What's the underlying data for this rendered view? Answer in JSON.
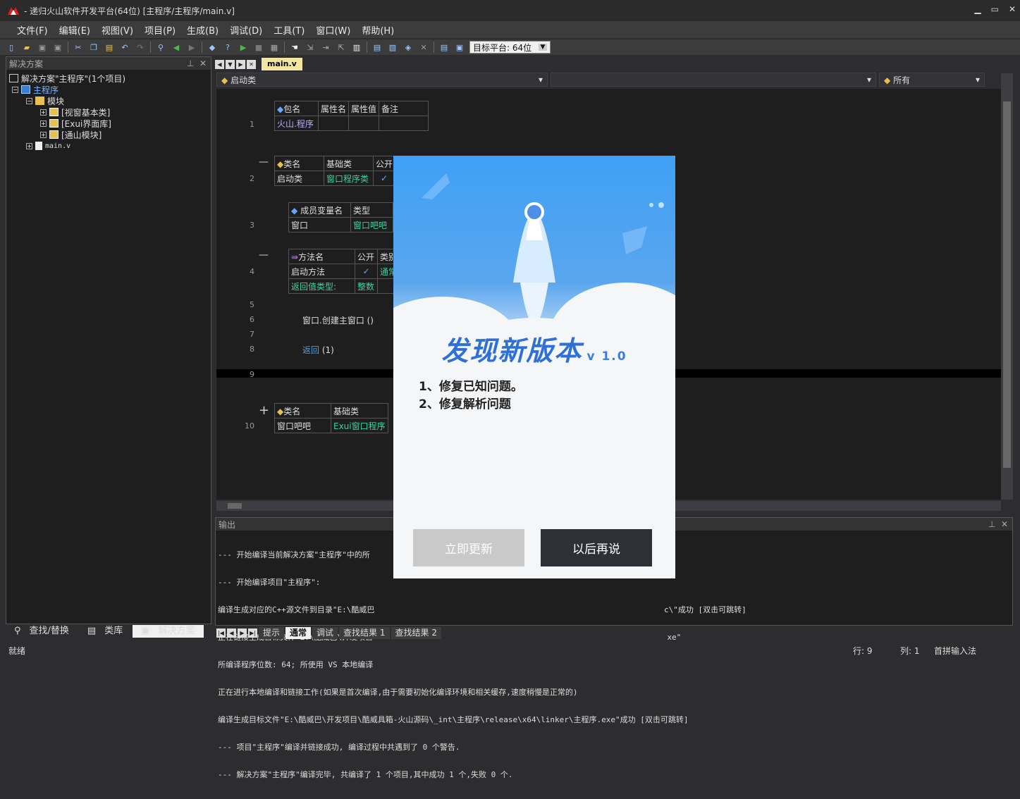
{
  "window": {
    "title": "- 递归火山软件开发平台(64位) [主程序/主程序/main.v]"
  },
  "menu": [
    "文件(F)",
    "编辑(E)",
    "视图(V)",
    "项目(P)",
    "生成(B)",
    "调试(D)",
    "工具(T)",
    "窗口(W)",
    "帮助(H)"
  ],
  "toolbar": {
    "platform_label": "目标平台: 64位"
  },
  "solution_panel": {
    "title": "解决方案",
    "root": "解决方案\"主程序\"(1个项目)",
    "project": "主程序",
    "folder": "模块",
    "modules": [
      "[视窗基本类]",
      "[Exui界面库]",
      "[通山模块]"
    ],
    "file": "main.v"
  },
  "left_tabs": [
    "查找/替换",
    "类库",
    "解决方案"
  ],
  "editor": {
    "tab": "main.v",
    "class_combo": "启动类",
    "member_combo": "",
    "filter_combo": "所有",
    "line_numbers": [
      "1",
      "2",
      "3",
      "4",
      "5",
      "6",
      "7",
      "8",
      "9",
      "10"
    ],
    "pkg_table": {
      "headers": [
        "包名",
        "属性名",
        "属性值",
        "备注"
      ],
      "row": [
        "火山.程序",
        "",
        "",
        ""
      ]
    },
    "class_table": {
      "headers": [
        "类名",
        "基础类",
        "公开"
      ],
      "row": [
        "启动类",
        "窗口程序类",
        "✓"
      ]
    },
    "member_table": {
      "headers": [
        "成员变量名",
        "类型"
      ],
      "row": [
        "窗口",
        "窗口吧吧"
      ]
    },
    "method_table": {
      "headers": [
        "方法名",
        "公开",
        "类别"
      ],
      "row": [
        "启动方法",
        "✓",
        "通常"
      ],
      "ret_label": "返回值类型:",
      "ret_type": "整数"
    },
    "code_line6": "窗口.创建主窗口 ()",
    "code_line8_kw": "返回",
    "code_line8_arg": "(1)",
    "class2_table": {
      "headers": [
        "类名",
        "基础类"
      ],
      "row": [
        "窗口吧吧",
        "Exui窗口程序"
      ]
    }
  },
  "output": {
    "title": "输出",
    "lines": [
      "--- 开始编译当前解决方案\"主程序\"中的所",
      "--- 开始编译项目\"主程序\":",
      "编译生成对应的C++源文件到目录\"E:\\酷威巴                                                              c\\\"成功 [双击可跳转]",
      "正在链接生成目标文件\"E:\\酷威巴\\开发项目                                                               xe\"",
      "所编译程序位数: 64; 所使用 VS 本地编译",
      "正在进行本地编译和链接工作(如果是首次编译,由于需要初始化编译环境和相关缓存,速度稍慢是正常的)",
      "编译生成目标文件\"E:\\酷威巴\\开发项目\\酷威具箱-火山源码\\_int\\主程序\\release\\x64\\linker\\主程序.exe\"成功 [双击可跳转]",
      "--- 项目\"主程序\"编译并链接成功, 编译过程中共遇到了 0 个警告.",
      "--- 解决方案\"主程序\"编译完毕, 共编译了 1 个项目,其中成功 1 个,失败 0 个."
    ]
  },
  "output_tabs": [
    "提示",
    "通常",
    "调试",
    "查找结果 1",
    "查找结果 2"
  ],
  "status": {
    "ready": "就绪",
    "row": "行: 9",
    "col": "列: 1",
    "ime": "首拼输入法"
  },
  "dialog": {
    "title": "发现新版本",
    "version": "v 1.0",
    "notes": [
      "1、修复已知问题。",
      "2、修复解析问题"
    ],
    "update_button": "立即更新",
    "later_button": "以后再说"
  }
}
